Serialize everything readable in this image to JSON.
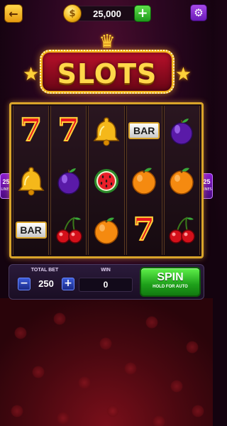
{
  "header": {
    "back_icon": "arrow-left-icon",
    "coins": "25,000",
    "coin_icon": "coin-icon",
    "add_icon": "plus-icon",
    "settings_icon": "gear-icon"
  },
  "logo": {
    "title": "SLOTS",
    "crown_icon": "crown-icon",
    "star_icon": "star-icon"
  },
  "reels": [
    [
      "seven",
      "bell",
      "bar"
    ],
    [
      "seven",
      "plum",
      "cherry"
    ],
    [
      "bell",
      "watermelon",
      "orange"
    ],
    [
      "bar",
      "orange",
      "seven"
    ],
    [
      "plum",
      "orange",
      "cherry"
    ]
  ],
  "symbols": {
    "bar_label": "BAR",
    "seven_label": "7"
  },
  "lines": {
    "left_count": "25",
    "right_count": "25",
    "label": "LINES"
  },
  "controls": {
    "total_bet_label": "TOTAL BET",
    "bet_value": "250",
    "minus_label": "−",
    "plus_label": "+",
    "win_label": "WIN",
    "win_value": "0",
    "spin_label": "SPIN",
    "spin_sub": "HOLD FOR AUTO"
  },
  "colors": {
    "accent_gold": "#f2b21a",
    "spin_green": "#1ea01a",
    "background": "#2a0620"
  }
}
